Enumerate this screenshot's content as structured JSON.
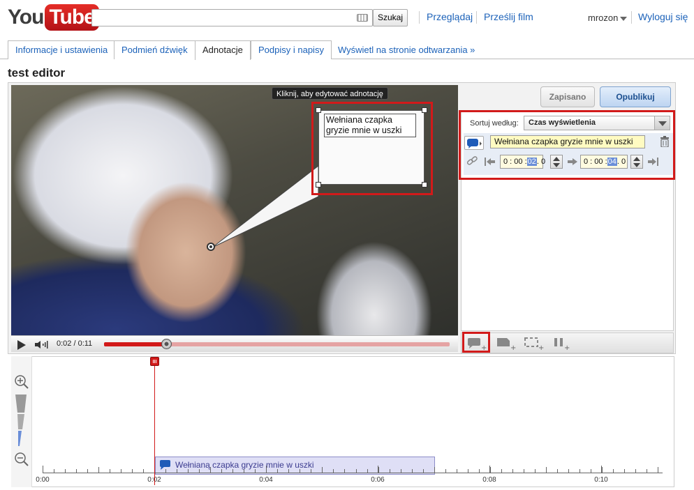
{
  "header": {
    "logo_you": "You",
    "logo_tube": "Tube",
    "search_button": "Szukaj",
    "nav_browse": "Przeglądaj",
    "nav_upload": "Prześlij film",
    "username": "mrozon",
    "logout": "Wyloguj się"
  },
  "tabs": [
    {
      "label": "Informacje i ustawienia"
    },
    {
      "label": "Podmień dźwięk"
    },
    {
      "label": "Adnotacje"
    },
    {
      "label": "Podpisy i napisy"
    }
  ],
  "tab_link": "Wyświetl na stronie odtwarzania »",
  "page_title": "test editor",
  "video": {
    "tooltip": "Kliknij, aby edytować adnotację",
    "annotation_text": "Wełniana czapka gryzie mnie w uszki"
  },
  "player": {
    "time": "0:02 / 0:11",
    "progress_fraction": 0.18
  },
  "panel": {
    "saved_button": "Zapisano",
    "publish_button": "Opublikuj",
    "sort_label": "Sortuj według:",
    "sort_value": "Czas wyświetlenia",
    "annotation_text": "Wełniana czapka gryzie mnie w uszki",
    "start_time": {
      "pre": "0 : 00 :",
      "hl": "02",
      "post": ". 0"
    },
    "end_time": {
      "pre": "0 : 00 :",
      "hl": "04",
      "post": ". 0"
    }
  },
  "tools": [
    "speech-bubble-add-icon",
    "note-add-icon",
    "spotlight-add-icon",
    "pause-add-icon"
  ],
  "timeline": {
    "annotation_label": "Wełnianą czapka gryzie mnie w uszki",
    "tick_labels": [
      "0:00",
      "0:02",
      "0:04",
      "0:06",
      "0:08",
      "0:10"
    ]
  },
  "colors": {
    "accent_red": "#d21a1a",
    "link_blue": "#1c62b9"
  }
}
